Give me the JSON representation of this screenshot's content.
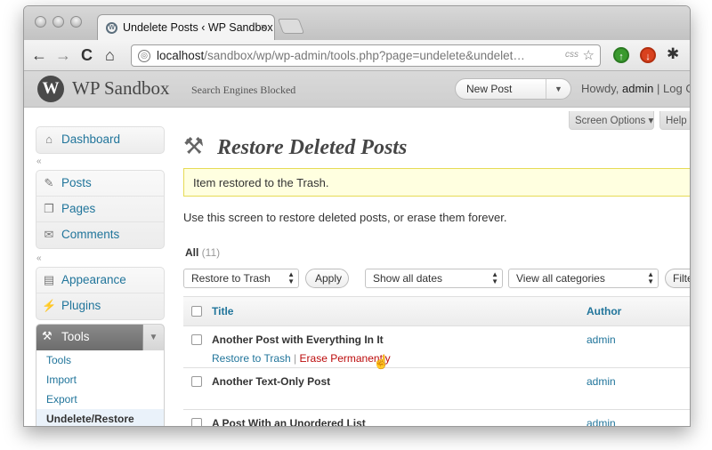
{
  "browser": {
    "tab_title": "Undelete Posts ‹ WP Sandbox — ...",
    "tab_close": "×",
    "url_host": "localhost",
    "url_path": "/sandbox/wp/wp-admin/tools.php?page=undelete&undelet…",
    "url_badge": "css",
    "nav": {
      "back": "←",
      "forward": "→",
      "reload": "C",
      "home": "⌂",
      "star": "☆",
      "wrench": "🔧"
    }
  },
  "wp_header": {
    "logo": "W",
    "site_title": "WP Sandbox",
    "site_status": "Search Engines Blocked",
    "favorite_action": "New Post",
    "favorite_toggle": "▼",
    "howdy_prefix": "Howdy, ",
    "user": "admin",
    "logout": " | Log O"
  },
  "screen_meta": {
    "options": "Screen Options ▾",
    "help": "Help ▾"
  },
  "sidebar": {
    "collapse": "«",
    "top": [
      {
        "label": "Dashboard",
        "icon": "⌂"
      }
    ],
    "content_items": [
      {
        "label": "Posts",
        "icon": "✎"
      },
      {
        "label": "Pages",
        "icon": "❐"
      },
      {
        "label": "Comments",
        "icon": "✉"
      }
    ],
    "appearance_items": [
      {
        "label": "Appearance",
        "icon": "▤"
      },
      {
        "label": "Plugins",
        "icon": "⚡"
      }
    ],
    "tools": {
      "label": "Tools",
      "icon": "⚒",
      "toggle": "▼",
      "submenu": [
        "Tools",
        "Import",
        "Export",
        "Undelete/Restore"
      ]
    }
  },
  "page": {
    "title": "Restore Deleted Posts",
    "icon": "⚒",
    "notice": "Item restored to the Trash.",
    "intro": "Use this screen to restore deleted posts, or erase them forever.",
    "filter_all": "All",
    "filter_count": " (11)",
    "bulk_action": "Restore to Trash",
    "apply": "Apply",
    "dates": "Show all dates",
    "categories": "View all categories",
    "filter_btn": "Filter",
    "select_arrows": "▲\n▼"
  },
  "table": {
    "columns": {
      "title": "Title",
      "author": "Author"
    },
    "rows": [
      {
        "title": "Another Post with Everything In It",
        "author": "admin",
        "restore": "Restore to Trash",
        "sep": " | ",
        "erase": "Erase Permanently"
      },
      {
        "title": "Another Text-Only Post",
        "author": "admin"
      },
      {
        "title": "A Post With an Unordered List",
        "author": "admin"
      }
    ]
  },
  "colors": {
    "link": "#21759b",
    "erase": "#bc0b0b",
    "notice_bg": "#ffffe0",
    "notice_border": "#e6db55"
  }
}
